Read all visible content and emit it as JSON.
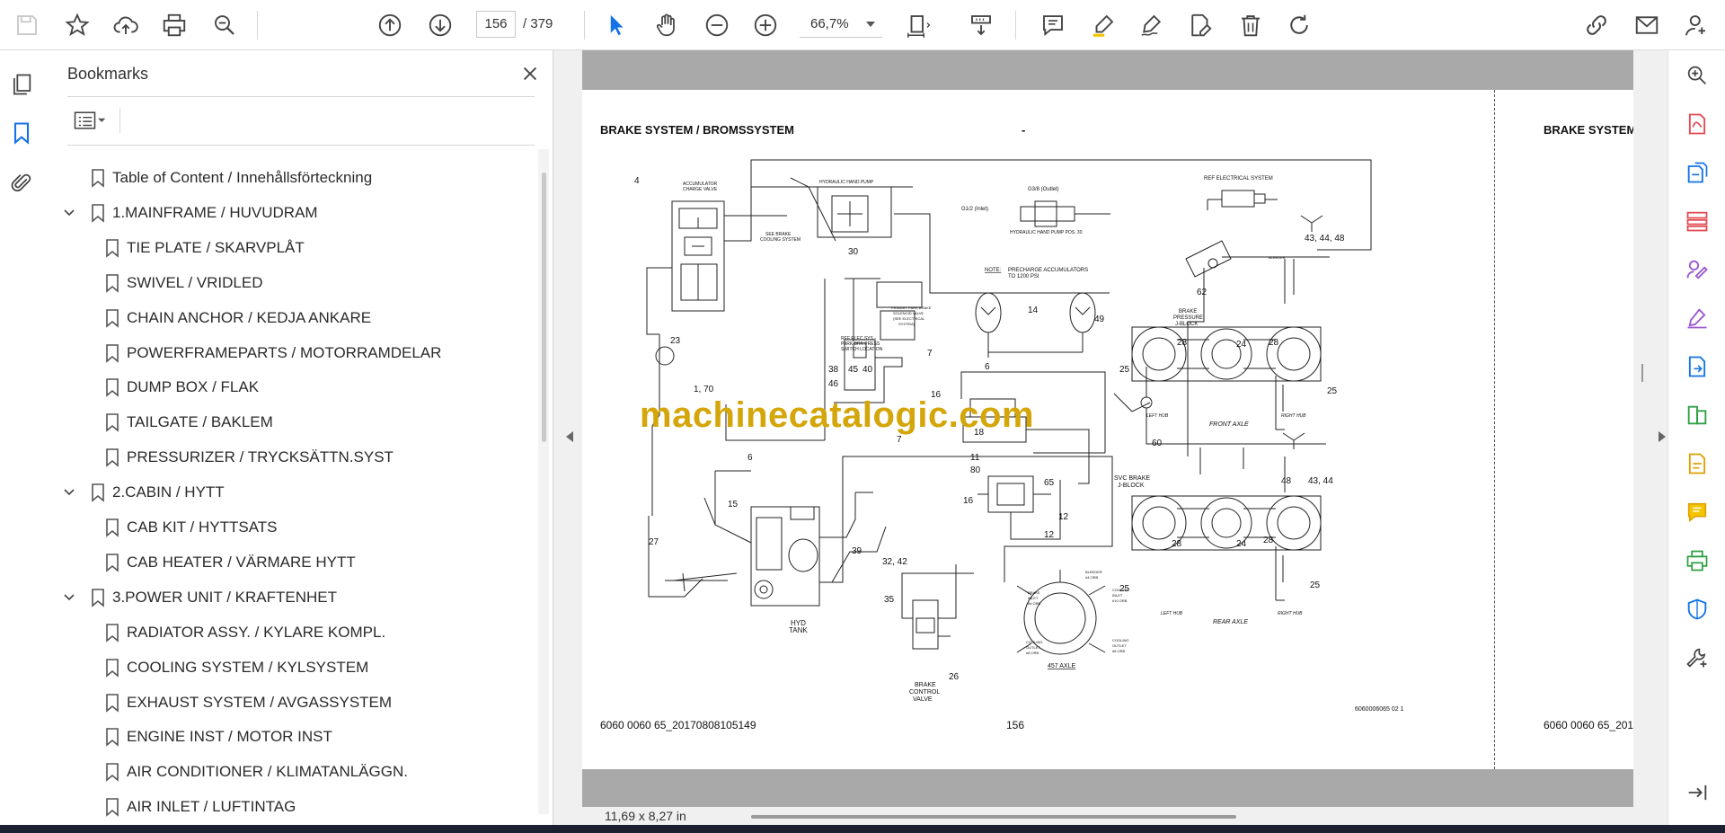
{
  "toolbar": {
    "page_current": "156",
    "page_total": "/ 379",
    "zoom": "66,7%"
  },
  "panel": {
    "title": "Bookmarks",
    "items": [
      {
        "label": "Table of Content / Innehållsförteckning",
        "level": 0,
        "expandable": false
      },
      {
        "label": "1.MAINFRAME / HUVUDRAM",
        "level": 0,
        "expandable": true
      },
      {
        "label": "TIE PLATE / SKARVPLÅT",
        "level": 1,
        "expandable": false
      },
      {
        "label": "SWIVEL / VRIDLED",
        "level": 1,
        "expandable": false
      },
      {
        "label": "CHAIN ANCHOR / KEDJA ANKARE",
        "level": 1,
        "expandable": false
      },
      {
        "label": "POWERFRAMEPARTS / MOTORRAMDELAR",
        "level": 1,
        "expandable": false
      },
      {
        "label": "DUMP BOX / FLAK",
        "level": 1,
        "expandable": false
      },
      {
        "label": "TAILGATE / BAKLEM",
        "level": 1,
        "expandable": false
      },
      {
        "label": "PRESSURIZER / TRYCKSÄTTN.SYST",
        "level": 1,
        "expandable": false
      },
      {
        "label": "2.CABIN / HYTT",
        "level": 0,
        "expandable": true
      },
      {
        "label": "CAB KIT / HYTTSATS",
        "level": 1,
        "expandable": false
      },
      {
        "label": "CAB HEATER / VÄRMARE HYTT",
        "level": 1,
        "expandable": false
      },
      {
        "label": "3.POWER UNIT / KRAFTENHET",
        "level": 0,
        "expandable": true
      },
      {
        "label": "RADIATOR ASSY. / KYLARE KOMPL.",
        "level": 1,
        "expandable": false
      },
      {
        "label": "COOLING SYSTEM / KYLSYSTEM",
        "level": 1,
        "expandable": false
      },
      {
        "label": "EXHAUST SYSTEM / AVGASSYSTEM",
        "level": 1,
        "expandable": false
      },
      {
        "label": "ENGINE INST / MOTOR INST",
        "level": 1,
        "expandable": false
      },
      {
        "label": "AIR CONDITIONER / KLIMATANLÄGGN.",
        "level": 1,
        "expandable": false
      },
      {
        "label": "AIR INLET / LUFTINTAG",
        "level": 1,
        "expandable": false
      }
    ]
  },
  "document": {
    "title": "BRAKE SYSTEM / BROMSSYSTEM",
    "title_dash": "-",
    "title_next": "BRAKE SYSTEM",
    "footer_left": "6060 0060 65_20170808105149",
    "footer_next": "6060 0060 65_2017",
    "page_number": "156",
    "drawing_code": "6060006065 02 1",
    "watermark": "machinecatalogic.com"
  },
  "diagram": {
    "labels": {
      "n4": "4",
      "acc_valve": "ACCUMULATOR",
      "acc_valve2": "CHARGE VALVE",
      "see_brake": "SEE BRAKE",
      "see_brake2": "COOLING SYSTEM",
      "hand_pump": "HYDRAULIC HAND PUMP",
      "n30": "30",
      "g38": "G3/8 (Outlet)",
      "g12": "G1/2 (Inlet)",
      "hand_pump_pos": "HYDRAULIC HAND PUMP POS. 30",
      "ref_elec": "REF ELECTRICAL SYSTEM",
      "n43_44_48": "43, 44, 48",
      "bleeder": "BLEEDER",
      "note": "NOTE:",
      "note_text": "PRECHARGE ACCUMULATORS",
      "note_text2": "TO 1200 PSI",
      "n62": "62",
      "brake_pressure": "BRAKE",
      "brake_pressure2": "PRESSURE",
      "brake_pressure3": "J-BLOCK",
      "n14": "14",
      "n49": "49",
      "n6a": "6",
      "n23": "23",
      "n1_70": "1, 70",
      "primary_park": "PRIMARY PARK BRAKE",
      "solenoid": "SOLENOID VALVE",
      "see_elec": "(SEE ELECTRICAL",
      "system": "SYSTEM)",
      "ref_elec_sys": "REF ELEC SYS -",
      "park_brk": "PARK BRK PRESS",
      "switch_loc": "SWITCH LOCATION",
      "n7a": "7",
      "n38": "38",
      "n45": "45",
      "n40": "40",
      "n46": "46",
      "n16a": "16",
      "n7b": "7",
      "n28a": "28",
      "n24a": "24",
      "n28b": "28",
      "n25a": "25",
      "n25b": "25",
      "left_hub": "LEFT HUB",
      "front_axle": "FRONT AXLE",
      "right_hub": "RIGHT HUB",
      "n6b": "6",
      "n18": "18",
      "n11": "11",
      "n80": "80",
      "n60": "60",
      "svc_brake": "SVC BRAKE",
      "svc_brake2": "J-BLOCK",
      "n65": "65",
      "n16b": "16",
      "n12a": "12",
      "n12b": "12",
      "n15": "15",
      "n27": "27",
      "n39": "39",
      "n32_42": "32, 42",
      "n35": "35",
      "hyd_tank": "HYD",
      "hyd_tank2": "TANK",
      "n48": "48",
      "n43_44": "43, 44",
      "n28c": "28",
      "n24b": "24",
      "n28d": "28",
      "n25c": "25",
      "n25d": "25",
      "left_hub2": "LEFT HUB",
      "rear_axle": "REAR AXLE",
      "right_hub2": "RIGHT HUB",
      "brake_inlet": "BRAKE",
      "brake_inlet2": "INLET",
      "brake_inlet3": "#6 ORB",
      "bleeder4": "BLEEDER",
      "bleeder4b": "#4 ORB",
      "cooling_inlet": "COOLING",
      "cooling_inlet2": "INLET",
      "cooling_inlet3": "#10 ORB",
      "cooling_outlet": "COOLING",
      "cooling_outlet2": "OUTLET",
      "cooling_outlet3": "#8 ORB",
      "cooling_outlet_b": "COOLING",
      "cooling_outlet_b2": "OUTLET",
      "cooling_outlet_b3": "#8 ORB",
      "axle457": "457 AXLE",
      "n26": "26",
      "brake_ctrl": "BRAKE",
      "brake_ctrl2": "CONTROL",
      "brake_ctrl3": "VALVE"
    }
  },
  "status": {
    "page_size": "11,69 x 8,27 in"
  },
  "colors": {
    "accent_blue": "#1473e6",
    "acrobat_red": "#e34850",
    "acrobat_purple": "#9b59d0",
    "watermark": "#d4a60a"
  }
}
